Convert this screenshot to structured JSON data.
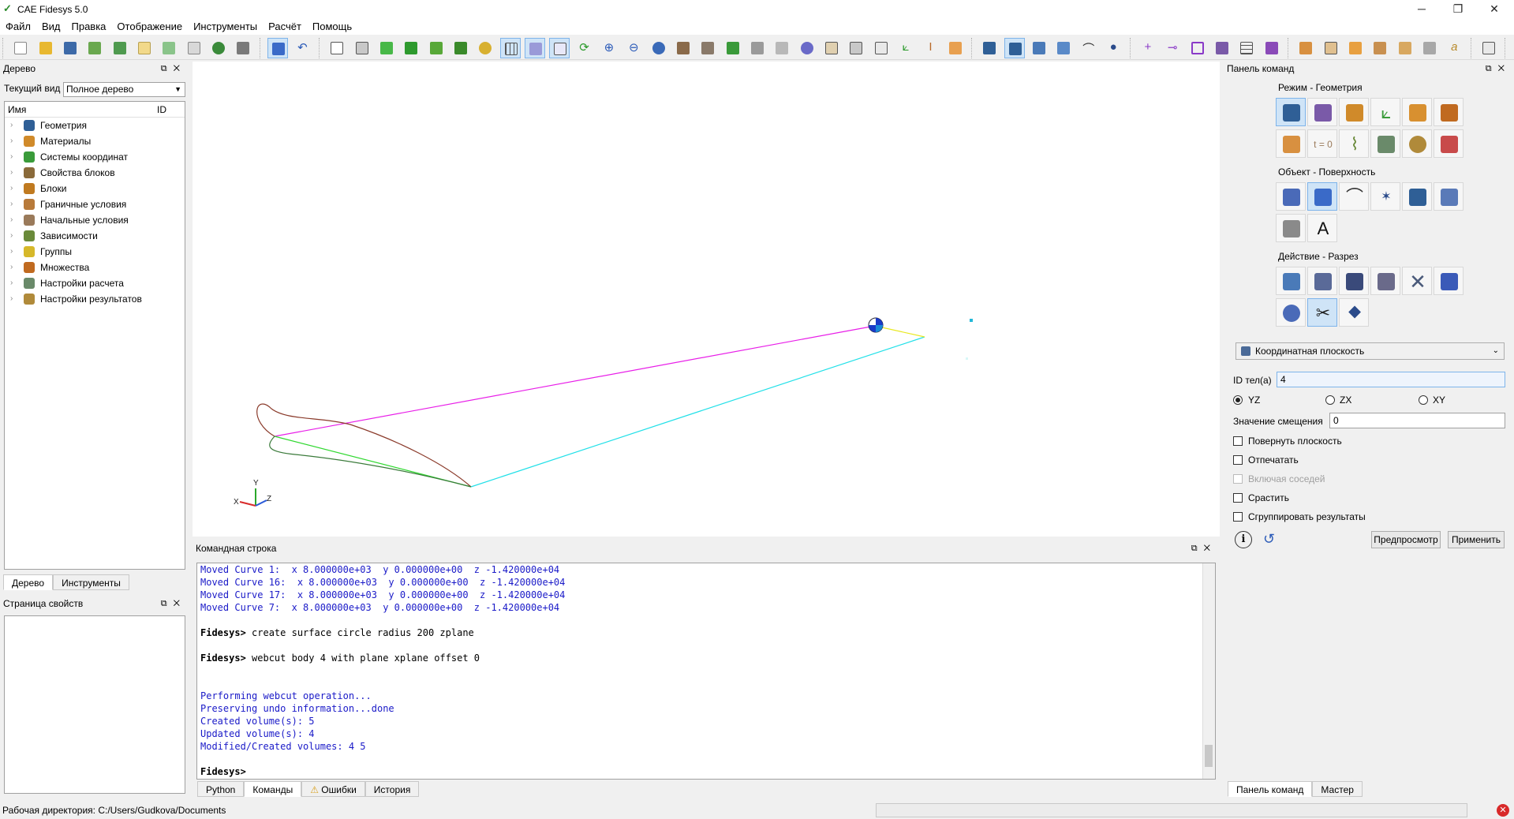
{
  "window": {
    "title": "CAE Fidesys 5.0",
    "min": "─",
    "max": "❐",
    "close": "✕"
  },
  "menu": [
    "Файл",
    "Вид",
    "Правка",
    "Отображение",
    "Инструменты",
    "Расчёт",
    "Помощь"
  ],
  "tree_panel": {
    "title": "Дерево",
    "current_view_label": "Текущий вид",
    "current_view_value": "Полное дерево",
    "col_name": "Имя",
    "col_id": "ID",
    "items": [
      {
        "label": "Геометрия",
        "color": "#2f5f96"
      },
      {
        "label": "Материалы",
        "color": "#d08a2a"
      },
      {
        "label": "Системы координат",
        "color": "#3a9b3a"
      },
      {
        "label": "Свойства блоков",
        "color": "#8a6a3a"
      },
      {
        "label": "Блоки",
        "color": "#c07a20"
      },
      {
        "label": "Граничные условия",
        "color": "#b87a3a"
      },
      {
        "label": "Начальные условия",
        "color": "#9a7a5a"
      },
      {
        "label": "Зависимости",
        "color": "#6a8a3a"
      },
      {
        "label": "Группы",
        "color": "#d6b82a"
      },
      {
        "label": "Множества",
        "color": "#c06a20"
      },
      {
        "label": "Настройки расчета",
        "color": "#6a8a6a"
      },
      {
        "label": "Настройки результатов",
        "color": "#b08a3a"
      }
    ],
    "tabs": [
      "Дерево",
      "Инструменты"
    ]
  },
  "properties_panel": {
    "title": "Страница свойств"
  },
  "viewport": {
    "axis_x": "X",
    "axis_y": "Y",
    "axis_z": "Z"
  },
  "command_panel": {
    "title": "Командная строка",
    "lines": [
      {
        "cls": "blue",
        "text": "Moved Curve 1:  x 8.000000e+03  y 0.000000e+00  z -1.420000e+04"
      },
      {
        "cls": "blue",
        "text": "Moved Curve 16:  x 8.000000e+03  y 0.000000e+00  z -1.420000e+04"
      },
      {
        "cls": "blue",
        "text": "Moved Curve 17:  x 8.000000e+03  y 0.000000e+00  z -1.420000e+04"
      },
      {
        "cls": "blue",
        "text": "Moved Curve 7:  x 8.000000e+03  y 0.000000e+00  z -1.420000e+04"
      },
      {
        "cls": "gap",
        "text": ""
      },
      {
        "cls": "blk",
        "prompt": "Fidesys>",
        "text": " create surface circle radius 200 zplane"
      },
      {
        "cls": "gap",
        "text": ""
      },
      {
        "cls": "blk",
        "prompt": "Fidesys>",
        "text": " webcut body 4 with plane xplane offset 0"
      },
      {
        "cls": "gap",
        "text": ""
      },
      {
        "cls": "gap",
        "text": ""
      },
      {
        "cls": "blue",
        "text": "Performing webcut operation..."
      },
      {
        "cls": "blue",
        "text": "Preserving undo information...done"
      },
      {
        "cls": "blue",
        "text": "Created volume(s): 5"
      },
      {
        "cls": "blue",
        "text": "Updated volume(s): 4"
      },
      {
        "cls": "blue",
        "text": "Modified/Created volumes: 4 5"
      },
      {
        "cls": "gap",
        "text": ""
      },
      {
        "cls": "blk",
        "prompt": "Fidesys>",
        "text": ""
      }
    ],
    "tabs": [
      "Python",
      "Команды",
      "Ошибки",
      "История"
    ]
  },
  "right_panel": {
    "title": "Панель команд",
    "mode_title": "Режим - Геометрия",
    "object_title": "Объект - Поверхность",
    "action_title": "Действие - Разрез",
    "mode_t0": "t = 0",
    "dropdown": "Координатная плоскость",
    "body_id_label": "ID тел(а)",
    "body_id_value": "4",
    "radio_yz": "YZ",
    "radio_zx": "ZX",
    "radio_xy": "XY",
    "offset_label": "Значение смещения",
    "offset_value": "0",
    "chk_rotate": "Повернуть плоскость",
    "chk_imprint": "Отпечатать",
    "chk_neighbors": "Включая соседей",
    "chk_merge": "Срастить",
    "chk_group": "Сгруппировать результаты",
    "preview_btn": "Предпросмотр",
    "apply_btn": "Применить",
    "tabs": [
      "Панель команд",
      "Мастер"
    ]
  },
  "status": {
    "workdir": "Рабочая директория: C:/Users/Gudkova/Documents"
  }
}
